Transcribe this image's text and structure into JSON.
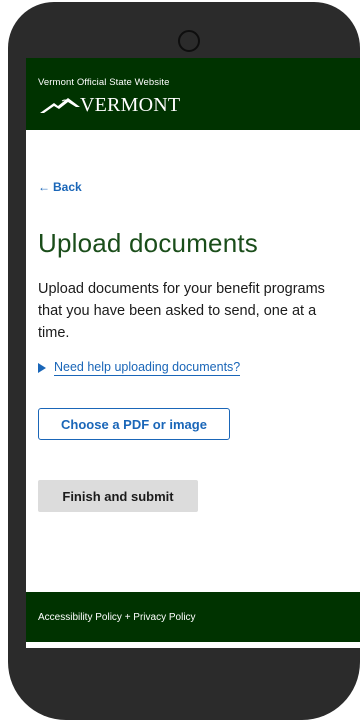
{
  "header": {
    "site_label": "Vermont Official State Website",
    "logo_text": "VERMONT",
    "background": "#003300"
  },
  "nav": {
    "back_label": "Back",
    "back_icon": "arrow-left-icon"
  },
  "main": {
    "title": "Upload documents",
    "intro": "Upload documents for your benefit programs that you have been asked to send, one at a time.",
    "help_toggle": "Need help uploading documents?",
    "choose_button": "Choose a PDF or image",
    "finish_button": "Finish and submit"
  },
  "footer": {
    "text": "Accessibility Policy + Privacy Policy"
  },
  "colors": {
    "link": "#1a66b8",
    "heading": "#1a4d1a",
    "disabled_button": "#dcdcdc"
  }
}
